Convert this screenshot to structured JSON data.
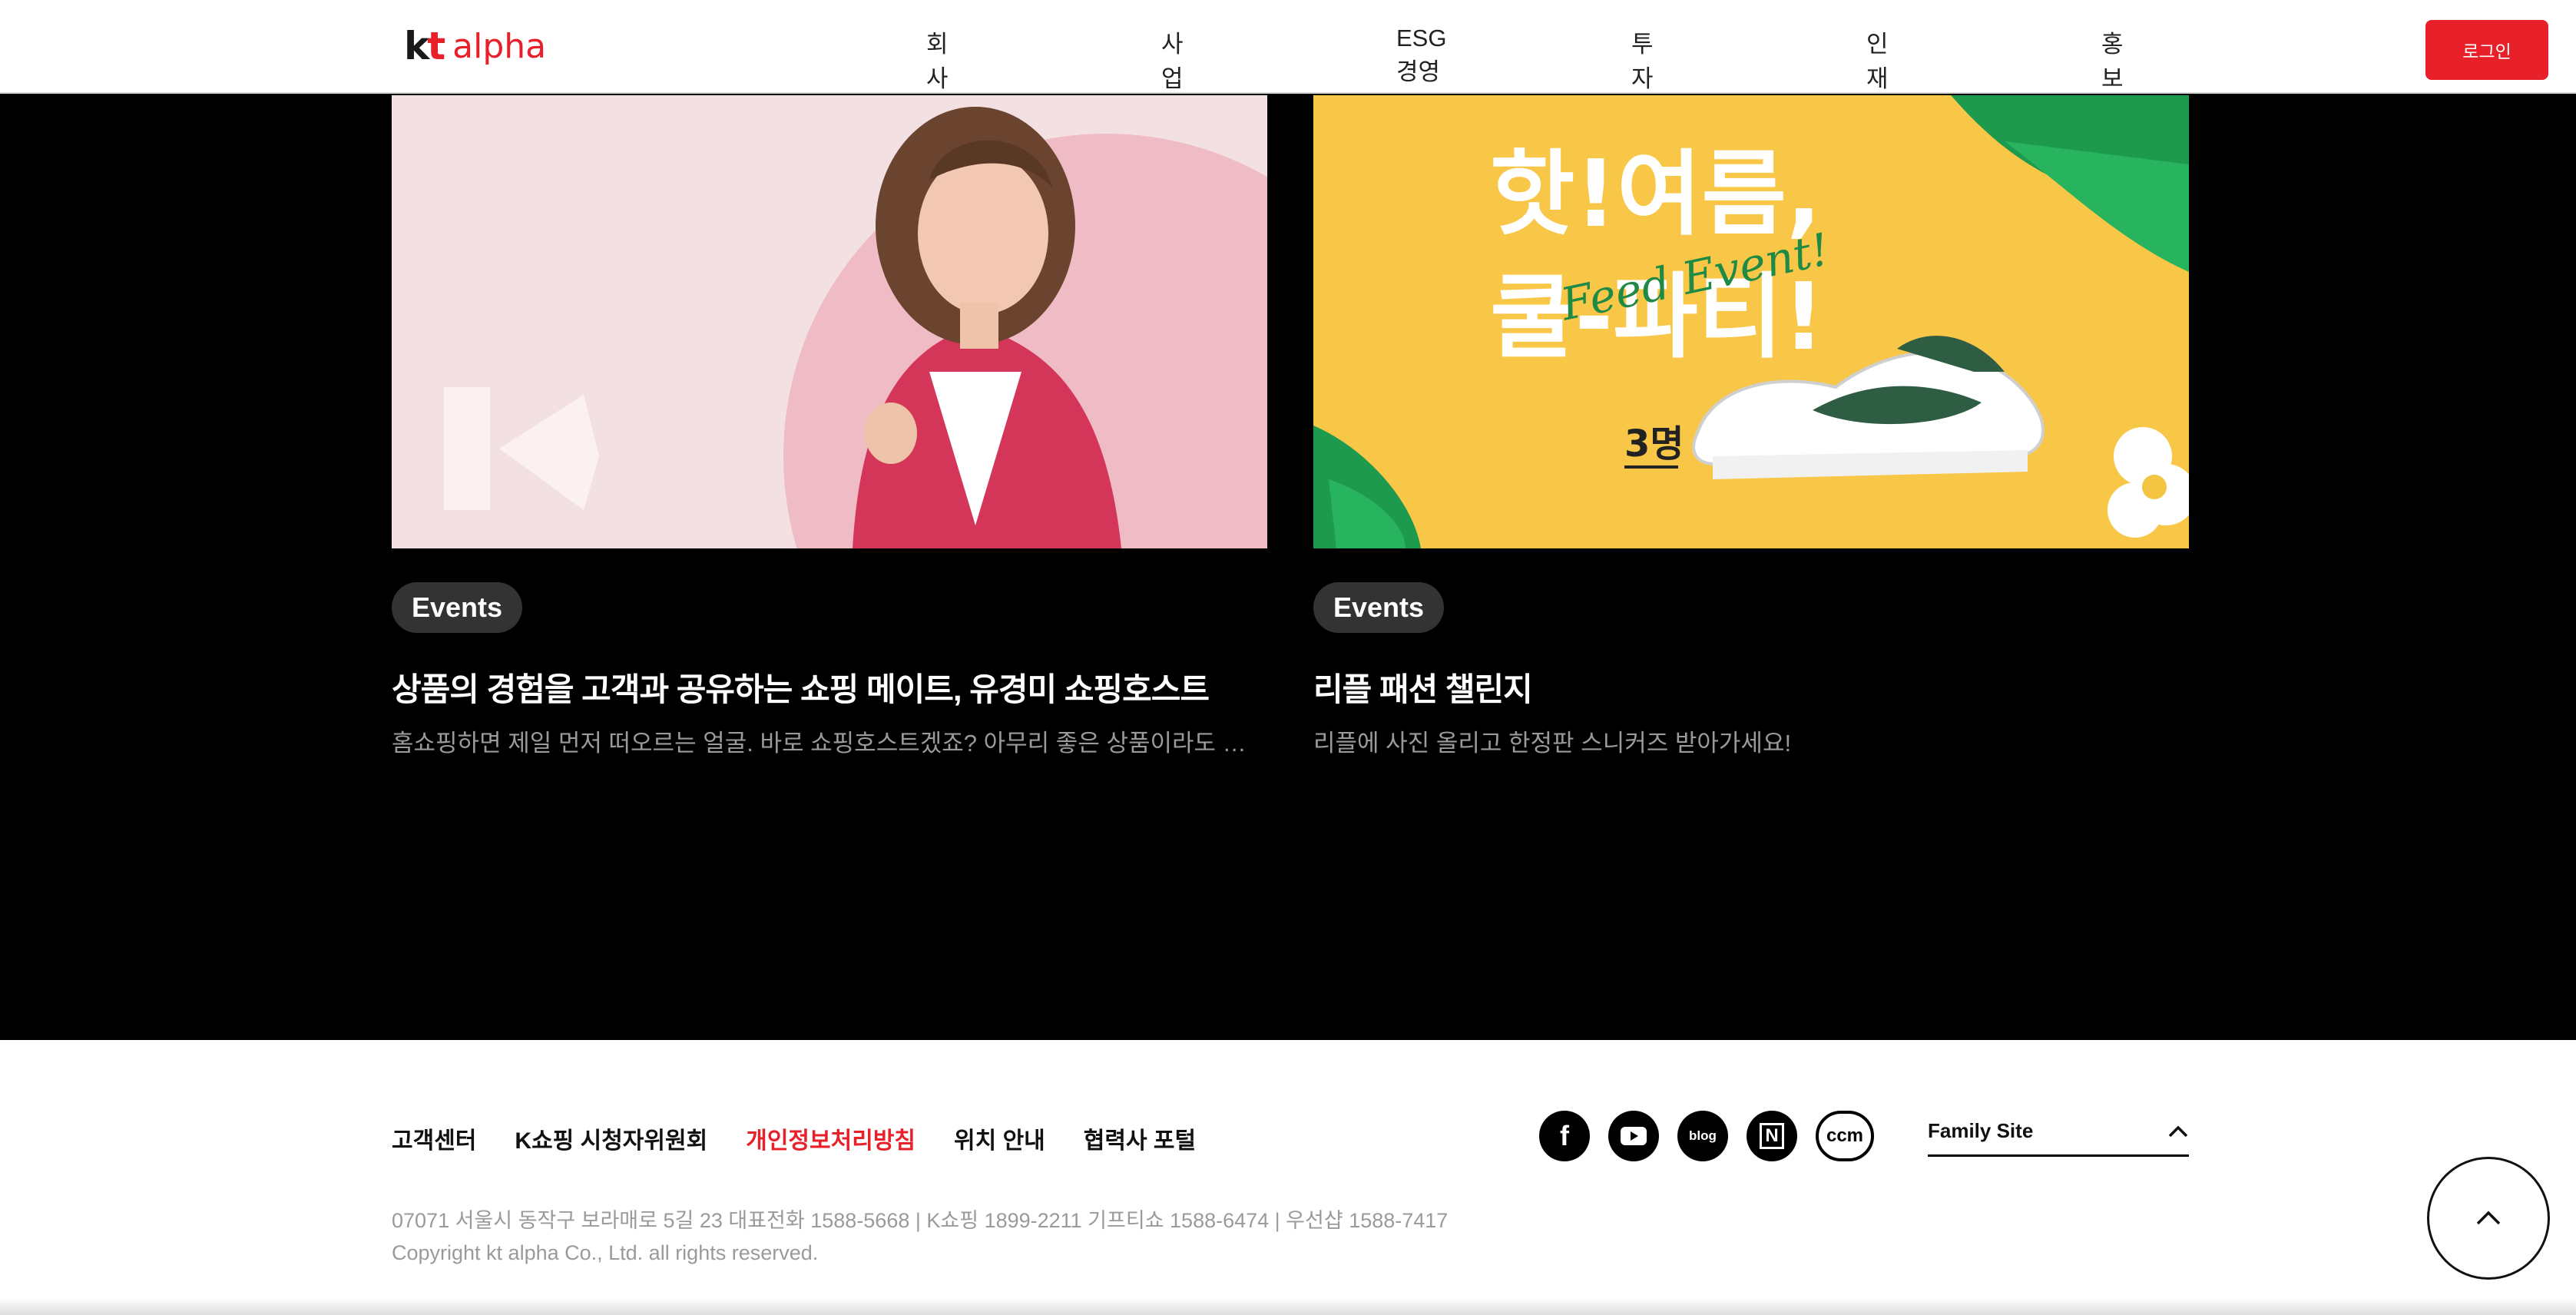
{
  "header": {
    "logo_kt": "kt",
    "logo_alpha": "alpha",
    "nav": [
      "회사소개",
      "사업소개",
      "ESG경영",
      "투자정보",
      "인재채용",
      "홍보채널"
    ],
    "login_label": "로그인"
  },
  "cards": [
    {
      "badge": "Events",
      "title": "상품의 경험을 고객과 공유하는 쇼핑 메이트, 유경미 쇼핑호스트",
      "desc": "홈쇼핑하면 제일 먼저 떠오르는 얼굴. 바로 쇼핑호스트겠죠? 아무리 좋은 상품이라도 상품..."
    },
    {
      "badge": "Events",
      "title": "리플 패션 챌린지",
      "desc": "리플에 사진 올리고 한정판 스니커즈 받아가세요!",
      "image_text": {
        "headline1": "핫!여름,",
        "headline2": "쿨-파티!",
        "script": "Feed Event!",
        "count": "3명"
      }
    }
  ],
  "footer": {
    "links": [
      "고객센터",
      "K쇼핑 시청자위원회",
      "개인정보처리방침",
      "위치 안내",
      "협력사 포털"
    ],
    "address": "07071 서울시 동작구 보라매로 5길 23 대표전화 1588-5668 | K쇼핑 1899-2211 기프티쇼 1588-6474 | 우선샵 1588-7417",
    "copyright": "Copyright kt alpha Co., Ltd. all rights reserved.",
    "social": [
      {
        "icon": "facebook-icon",
        "label": "f"
      },
      {
        "icon": "youtube-icon",
        "label": "▶"
      },
      {
        "icon": "blog-icon",
        "label": "blog"
      },
      {
        "icon": "naver-post-icon",
        "label": "N"
      },
      {
        "icon": "ccm-icon",
        "label": "ccm"
      }
    ],
    "family_site": "Family Site"
  },
  "colors": {
    "accent": "#e8202a",
    "background": "#000000"
  }
}
